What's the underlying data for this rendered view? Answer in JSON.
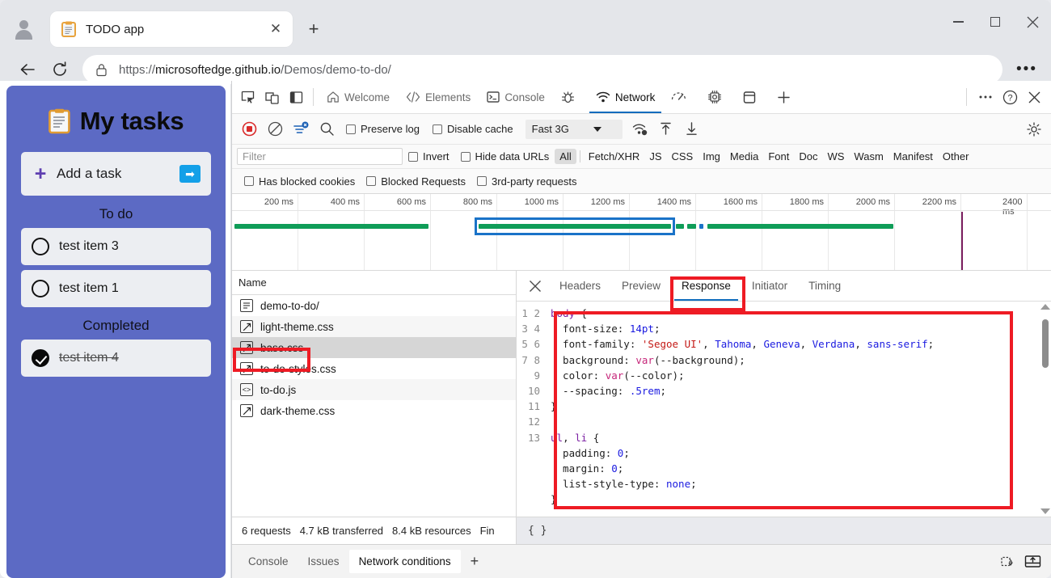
{
  "browser": {
    "tab": {
      "title": "TODO app",
      "favicon": "clipboard-icon",
      "close": "✕"
    },
    "new_tab_label": "+",
    "window_controls": {
      "minimize": "minimize-icon",
      "maximize": "maximize-icon",
      "close": "close-icon"
    },
    "nav": {
      "back": "back-arrow-icon",
      "reload": "reload-icon",
      "more": "•••"
    },
    "omnibox": {
      "lock": "lock-icon",
      "url_prefix": "https://",
      "url_host": "microsoftedge.github.io",
      "url_path": "/Demos/demo-to-do/",
      "full_url": "https://microsoftedge.github.io/Demos/demo-to-do/"
    }
  },
  "page": {
    "app_title": "My tasks",
    "accent_color": "#5c6ac4",
    "add_task": {
      "plus": "+",
      "label": "Add a task",
      "submit": "➡"
    },
    "sections": [
      {
        "label": "To do",
        "tasks": [
          {
            "text": "test item 3",
            "done": false
          },
          {
            "text": "test item 1",
            "done": false
          }
        ]
      },
      {
        "label": "Completed",
        "tasks": [
          {
            "text": "test item 4",
            "done": true
          }
        ]
      }
    ]
  },
  "devtools": {
    "left_icons": [
      "inspect-element-icon",
      "device-toolbar-icon",
      "dock-side-icon"
    ],
    "panels": [
      {
        "label": "Welcome",
        "icon": "home-icon",
        "selected": false
      },
      {
        "label": "Elements",
        "icon": "code-brackets-icon",
        "selected": false
      },
      {
        "label": "Console",
        "icon": "terminal-icon",
        "selected": false
      },
      {
        "label": "",
        "icon": "bug-icon",
        "selected": false
      },
      {
        "label": "Network",
        "icon": "network-wifi-icon",
        "selected": true
      },
      {
        "label": "",
        "icon": "performance-gauge-icon",
        "selected": false
      },
      {
        "label": "",
        "icon": "memory-chip-icon",
        "selected": false
      },
      {
        "label": "",
        "icon": "application-storage-icon",
        "selected": false
      },
      {
        "label": "",
        "icon": "add-panel-icon",
        "selected": false
      }
    ],
    "top_right": [
      "more-options-icon",
      "help-icon",
      "close-devtools-icon"
    ],
    "network_toolbar": {
      "record": "record-stop-icon",
      "clear": "clear-icon",
      "filter_toggle": "filter-icon",
      "search": "search-icon",
      "preserve_log": {
        "label": "Preserve log",
        "checked": false
      },
      "disable_cache": {
        "label": "Disable cache",
        "checked": false
      },
      "throttling": "Fast 3G",
      "throttle_settings": "network-conditions-icon",
      "import_har": "import-har-icon",
      "export_har": "export-har-icon",
      "settings": "settings-gear-icon"
    },
    "filter_bar": {
      "placeholder": "Filter",
      "value": "",
      "invert": {
        "label": "Invert",
        "checked": false
      },
      "hide_data_urls": {
        "label": "Hide data URLs",
        "checked": false
      },
      "types": [
        "All",
        "Fetch/XHR",
        "JS",
        "CSS",
        "Img",
        "Media",
        "Font",
        "Doc",
        "WS",
        "Wasm",
        "Manifest",
        "Other"
      ],
      "selected_type": "All"
    },
    "filter_bar2": [
      {
        "label": "Has blocked cookies",
        "checked": false
      },
      {
        "label": "Blocked Requests",
        "checked": false
      },
      {
        "label": "3rd-party requests",
        "checked": false
      }
    ],
    "overview": {
      "ticks": [
        "200 ms",
        "400 ms",
        "600 ms",
        "800 ms",
        "1000 ms",
        "1200 ms",
        "1400 ms",
        "1600 ms",
        "1800 ms",
        "2000 ms",
        "2200 ms",
        "2400 ms"
      ]
    },
    "requests": {
      "column_header": "Name",
      "rows": [
        {
          "name": "demo-to-do/",
          "type": "doc-icon",
          "selected": false
        },
        {
          "name": "light-theme.css",
          "type": "css-icon",
          "selected": false
        },
        {
          "name": "base.css",
          "type": "css-icon",
          "selected": true
        },
        {
          "name": "to-do-styles.css",
          "type": "css-icon",
          "selected": false
        },
        {
          "name": "to-do.js",
          "type": "js-icon",
          "selected": false
        },
        {
          "name": "dark-theme.css",
          "type": "css-icon",
          "selected": false
        }
      ]
    },
    "detail": {
      "tabs": [
        "Headers",
        "Preview",
        "Response",
        "Initiator",
        "Timing"
      ],
      "selected_tab": "Response",
      "close": "close-detail-icon",
      "code_lines": [
        "body {",
        "  font-size: 14pt;",
        "  font-family: 'Segoe UI', Tahoma, Geneva, Verdana, sans-serif;",
        "  background: var(--background);",
        "  color: var(--color);",
        "  --spacing: .5rem;",
        "}",
        "",
        "ul, li {",
        "  padding: 0;",
        "  margin: 0;",
        "  list-style-type: none;",
        "}"
      ],
      "line_numbers": [
        "1",
        "2",
        "3",
        "4",
        "5",
        "6",
        "7",
        "8",
        "9",
        "10",
        "11",
        "12",
        "13"
      ],
      "format_button": "{ }"
    },
    "summary": {
      "requests": "6 requests",
      "transferred": "4.7 kB transferred",
      "resources": "8.4 kB resources",
      "finish_truncated": "Fin"
    },
    "drawer": {
      "tabs": [
        "Console",
        "Issues",
        "Network conditions"
      ],
      "selected_tab": "Network conditions",
      "add": "+",
      "right_icons": [
        "clear-console-icon",
        "show-console-drawer-icon"
      ]
    },
    "highlight_color": "#ee1b24"
  }
}
